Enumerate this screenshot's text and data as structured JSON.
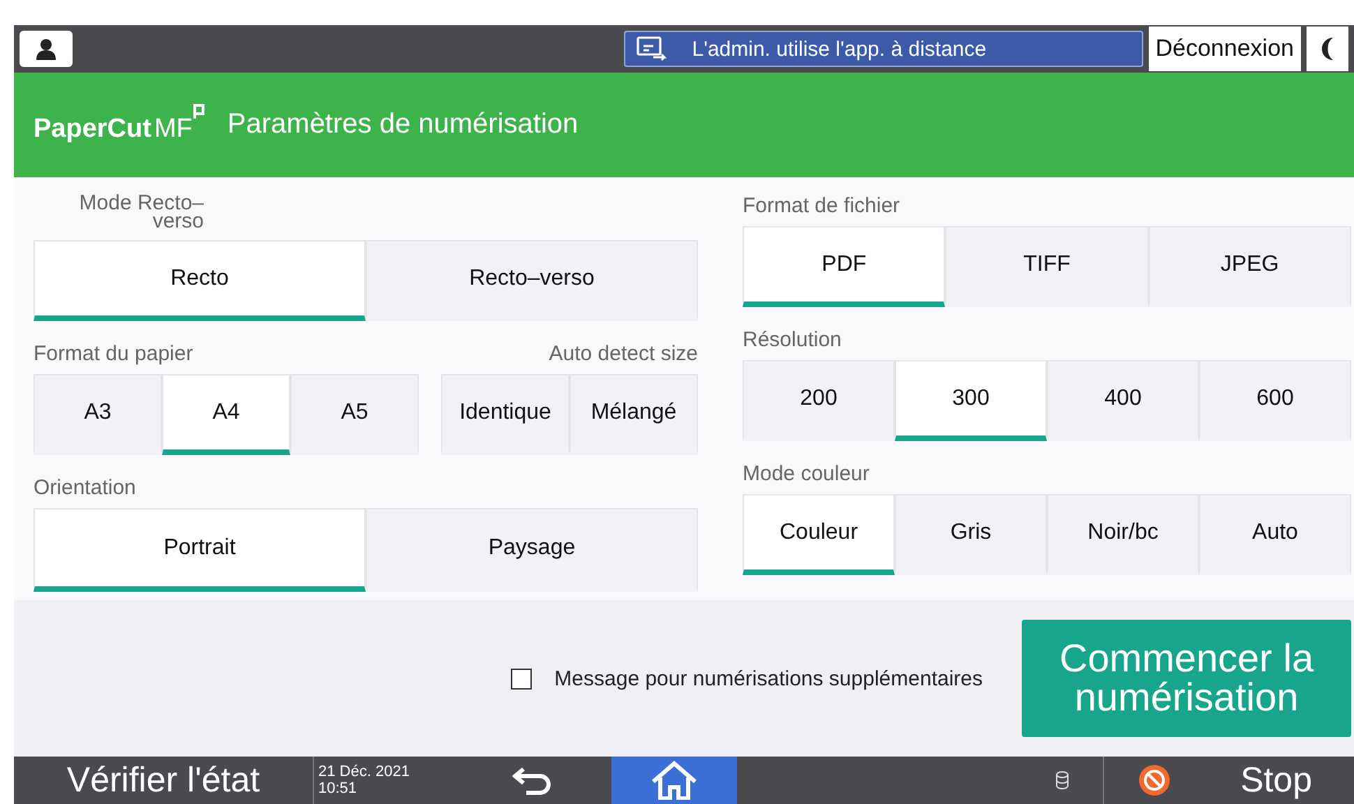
{
  "top_bar": {
    "notice": "L'admin. utilise l'app. à distance",
    "logout": "Déconnexion"
  },
  "header": {
    "logo": "PaperCut",
    "logo_suffix": "MF",
    "title": "Paramètres de numérisation"
  },
  "duplex": {
    "label_lines": [
      "Mode Recto–",
      "verso"
    ],
    "options": [
      {
        "label": "Recto",
        "selected": true
      },
      {
        "label": "Recto–verso",
        "selected": false
      }
    ]
  },
  "paper": {
    "label": "Format du papier",
    "auto_label": "Auto detect size",
    "sizes": [
      {
        "label": "A3",
        "selected": false
      },
      {
        "label": "A4",
        "selected": true
      },
      {
        "label": "A5",
        "selected": false
      }
    ],
    "auto_options": [
      {
        "label": "Identique",
        "selected": false
      },
      {
        "label": "Mélangé",
        "selected": false
      }
    ]
  },
  "orientation": {
    "label": "Orientation",
    "options": [
      {
        "label": "Portrait",
        "selected": true
      },
      {
        "label": "Paysage",
        "selected": false
      }
    ]
  },
  "file_format": {
    "label": "Format de fichier",
    "options": [
      {
        "label": "PDF",
        "selected": true
      },
      {
        "label": "TIFF",
        "selected": false
      },
      {
        "label": "JPEG",
        "selected": false
      }
    ]
  },
  "resolution": {
    "label": "Résolution",
    "options": [
      {
        "label": "200",
        "selected": false
      },
      {
        "label": "300",
        "selected": true
      },
      {
        "label": "400",
        "selected": false
      },
      {
        "label": "600",
        "selected": false
      }
    ]
  },
  "color_mode": {
    "label": "Mode couleur",
    "options": [
      {
        "label": "Couleur",
        "selected": true
      },
      {
        "label": "Gris",
        "selected": false
      },
      {
        "label": "Noir/bc",
        "selected": false
      },
      {
        "label": "Auto",
        "selected": false
      }
    ]
  },
  "extra_scans": {
    "label": "Message pour numérisations supplémentaires",
    "checked": false
  },
  "start_button": "Commencer la numérisation",
  "bottom_bar": {
    "status": "Vérifier l'état",
    "date": "21 Déc. 2021",
    "time": "10:51",
    "stop": "Stop"
  }
}
